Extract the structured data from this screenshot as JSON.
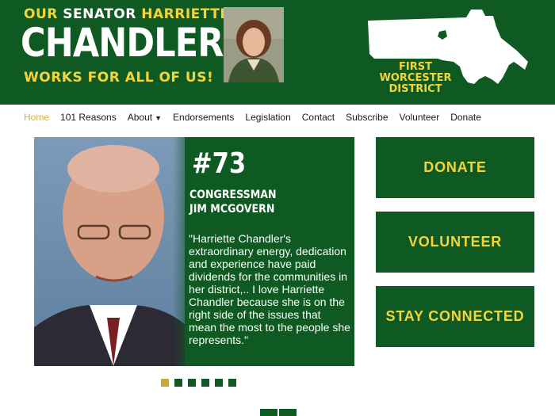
{
  "header": {
    "tagline_our": "OUR",
    "tagline_senator": "SENATOR",
    "tagline_first_name": "HARRIETTE",
    "name": "CHANDLER",
    "tagline_bottom": "WORKS FOR ALL OF US!",
    "district_line1": "FIRST WORCESTER",
    "district_line2": "DISTRICT"
  },
  "nav": {
    "items": [
      {
        "label": "Home"
      },
      {
        "label": "101 Reasons"
      },
      {
        "label": "About"
      },
      {
        "label": "Endorsements"
      },
      {
        "label": "Legislation"
      },
      {
        "label": "Contact"
      },
      {
        "label": "Subscribe"
      },
      {
        "label": "Volunteer"
      },
      {
        "label": "Donate"
      }
    ],
    "active": "Home"
  },
  "slide": {
    "number": "#73",
    "name_line1": "CONGRESSMAN",
    "name_line2": "JIM MCGOVERN",
    "quote": "\"Harriette Chandler's extraordinary energy, dedication and experience have paid dividends for the communities in her district,.. I love Harriette Chandler because she is on the right side of the issues that mean the most to the people she represents.\""
  },
  "slider": {
    "dot_count": 6,
    "active_dot": 1
  },
  "cta": {
    "donate": "DONATE",
    "volunteer": "VOLUNTEER",
    "stay_connected": "STAY CONNECTED"
  },
  "colors": {
    "brand_green": "#0f5a23",
    "accent_yellow": "#f2d53c",
    "nav_active": "#d4b13a"
  }
}
